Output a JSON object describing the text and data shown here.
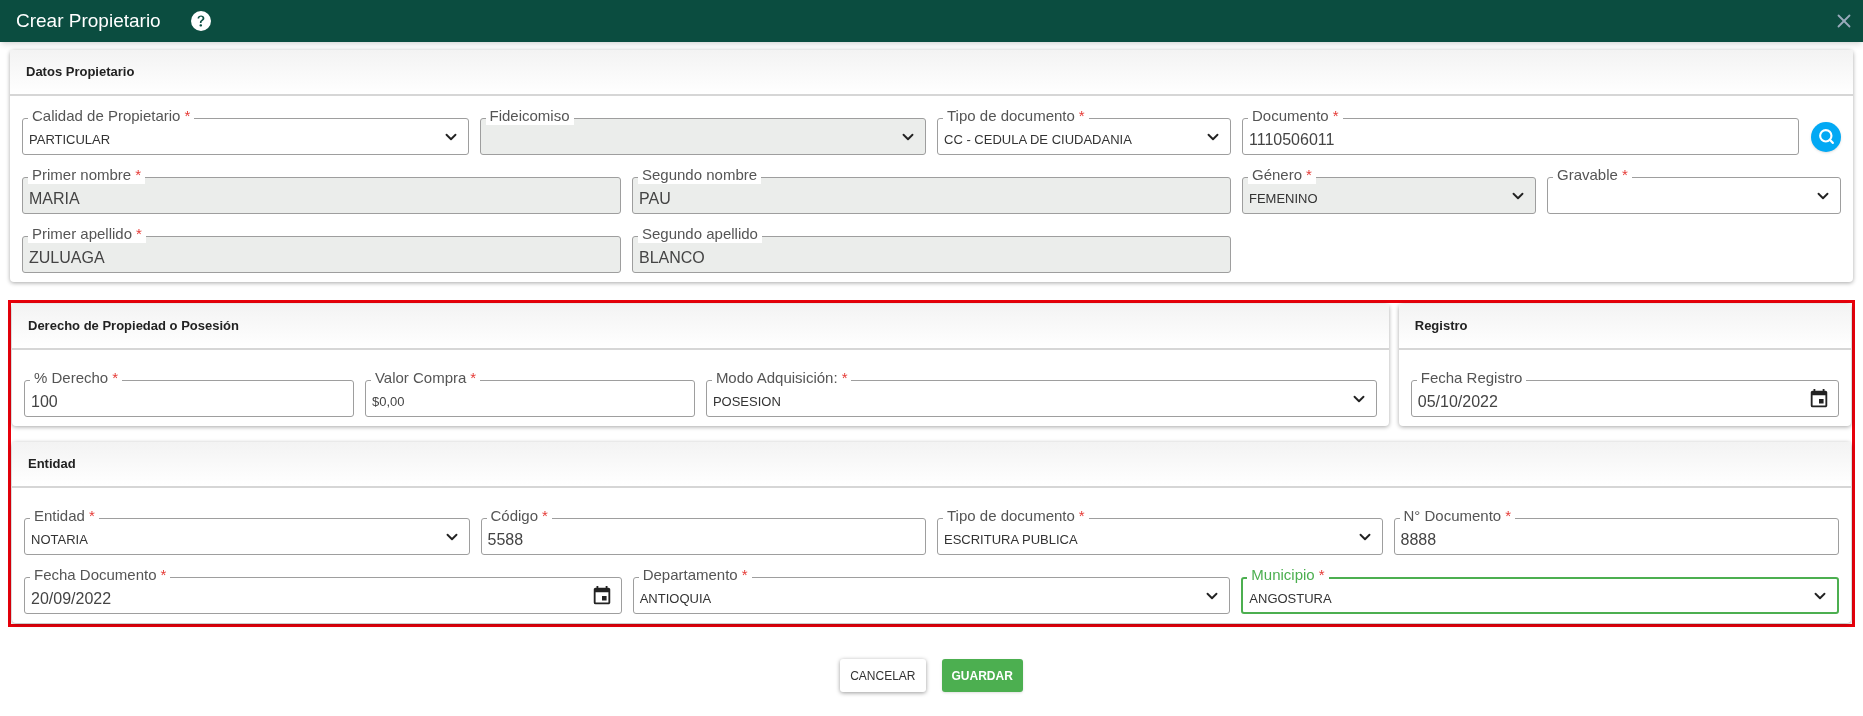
{
  "window": {
    "title": "Crear Propietario"
  },
  "sections": [
    {
      "title": "Datos Propietario",
      "fields": [
        {
          "kind": "select",
          "label": "Calidad de Propietario",
          "mark": "*",
          "value": "PARTICULAR",
          "disabled": false,
          "focused": false
        },
        {
          "kind": "select",
          "label": "Fideicomiso",
          "disabled": true,
          "focused": false
        },
        {
          "kind": "select",
          "label": "Tipo de documento",
          "mark": "*",
          "value": "CC - CEDULA DE CIUDADANIA",
          "disabled": false,
          "focused": false
        },
        {
          "kind": "search",
          "label": "Documento",
          "mark": "*",
          "value": "1110506011",
          "disabled": false,
          "focused": false
        },
        {
          "kind": "text",
          "label": "Primer nombre",
          "mark": "*",
          "value": "MARIA",
          "disabled": true,
          "focused": false
        },
        {
          "kind": "text",
          "label": "Segundo nombre",
          "value": "PAU",
          "disabled": true,
          "focused": false
        },
        {
          "kind": "select",
          "label": "Género",
          "mark": "*",
          "value": "FEMENINO",
          "disabled": true,
          "focused": false
        },
        {
          "kind": "select",
          "label": "Gravable",
          "mark": "*",
          "disabled": false,
          "focused": false
        },
        {
          "kind": "text",
          "label": "Primer apellido",
          "mark": "*",
          "value": "ZULUAGA",
          "disabled": true,
          "focused": false
        },
        {
          "kind": "text",
          "label": "Segundo apellido",
          "value": "BLANCO",
          "disabled": true,
          "focused": false
        }
      ]
    },
    {
      "title": "Derecho de Propiedad o Posesión",
      "fields": [
        {
          "kind": "text",
          "label": "% Derecho",
          "mark": "*",
          "value": "100",
          "disabled": false,
          "focused": false
        },
        {
          "kind": "money",
          "label": "Valor Compra",
          "mark": "*",
          "value": "$0,00",
          "disabled": false,
          "focused": false
        },
        {
          "kind": "select",
          "label": "Modo Adquisición:",
          "mark": "*",
          "value": "POSESION",
          "disabled": false,
          "focused": false
        }
      ]
    },
    {
      "title": "Registro",
      "fields": [
        {
          "kind": "date",
          "label": "Fecha Registro",
          "value": "05/10/2022",
          "disabled": false,
          "focused": false
        }
      ]
    },
    {
      "title": "Entidad",
      "fields": [
        {
          "kind": "select",
          "label": "Entidad",
          "mark": "*",
          "value": "NOTARIA",
          "disabled": false,
          "focused": false
        },
        {
          "kind": "text",
          "label": "Código",
          "mark": "*",
          "value": "5588",
          "disabled": false,
          "focused": false
        },
        {
          "kind": "select",
          "label": "Tipo de documento",
          "mark": "*",
          "value": "ESCRITURA PUBLICA",
          "disabled": false,
          "focused": false
        },
        {
          "kind": "text",
          "label": "N° Documento",
          "mark": "*",
          "value": "8888",
          "disabled": false,
          "focused": false
        },
        {
          "kind": "date",
          "label": "Fecha Documento",
          "mark": "*",
          "value": "20/09/2022",
          "disabled": false,
          "focused": false
        },
        {
          "kind": "select",
          "label": "Departamento",
          "mark": "*",
          "value": "ANTIOQUIA",
          "disabled": false,
          "focused": false
        },
        {
          "kind": "select",
          "label": "Municipio",
          "mark": "*",
          "value": "ANGOSTURA",
          "disabled": false,
          "focused": true
        }
      ]
    }
  ],
  "buttons": [
    {
      "kind": "secondary",
      "label": "CANCELAR"
    },
    {
      "kind": "primary",
      "label": "GUARDAR"
    }
  ]
}
